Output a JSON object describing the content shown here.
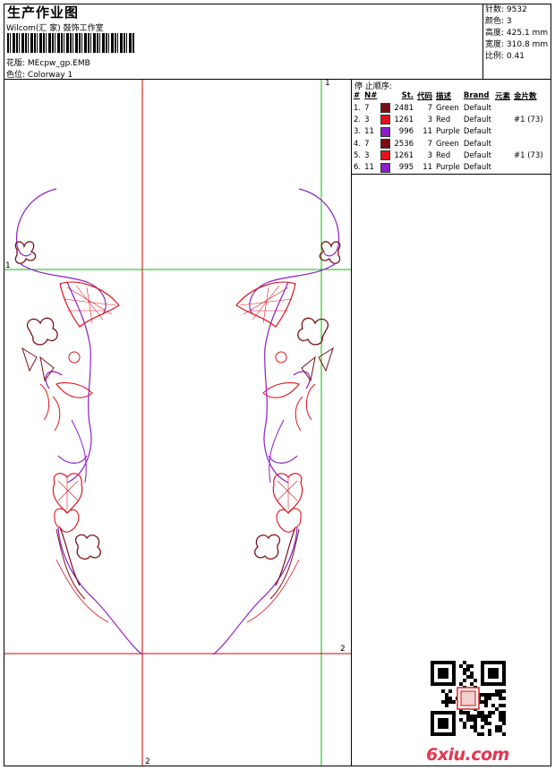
{
  "header": {
    "title": "生产作业图",
    "company": "Wilcom(汇 家) 鼓饰工作室",
    "design_label": "花版:",
    "design_value": "MEcpw_gp.EMB",
    "colorway_label": "色位:",
    "colorway_value": "Colorway 1"
  },
  "stats": {
    "stitches_label": "针数:",
    "stitches": "9532",
    "colors_label": "颜色:",
    "colors": "3",
    "height_label": "高度:",
    "height": "425.1 mm",
    "width_label": "宽度:",
    "width": "310.8 mm",
    "scale_label": "比例:",
    "scale": "0.41"
  },
  "sequence": {
    "title": "停 止顺序:",
    "headers": [
      "#",
      "N#",
      "St.",
      "代码",
      "描述",
      "Brand",
      "元素",
      "金片数"
    ],
    "rows": [
      {
        "idx": "1.",
        "n": "7",
        "color": "#7a0f14",
        "st": "2481",
        "code": "7",
        "desc": "Green",
        "brand": "Default",
        "elem": "",
        "seq": ""
      },
      {
        "idx": "2.",
        "n": "3",
        "color": "#e0141e",
        "st": "1261",
        "code": "3",
        "desc": "Red",
        "brand": "Default",
        "elem": "",
        "seq": "#1 (73)"
      },
      {
        "idx": "3.",
        "n": "11",
        "color": "#8a1ec8",
        "st": "996",
        "code": "11",
        "desc": "Purple",
        "brand": "Default",
        "elem": "",
        "seq": ""
      },
      {
        "idx": "4.",
        "n": "7",
        "color": "#7a0f14",
        "st": "2536",
        "code": "7",
        "desc": "Green",
        "brand": "Default",
        "elem": "",
        "seq": ""
      },
      {
        "idx": "5.",
        "n": "3",
        "color": "#e0141e",
        "st": "1261",
        "code": "3",
        "desc": "Red",
        "brand": "Default",
        "elem": "",
        "seq": "#1 (73)"
      },
      {
        "idx": "6.",
        "n": "11",
        "color": "#8a1ec8",
        "st": "995",
        "code": "11",
        "desc": "Purple",
        "brand": "Default",
        "elem": "",
        "seq": ""
      }
    ]
  },
  "guides": {
    "label_1_top": "1",
    "label_1_left": "1",
    "label_2_right": "2",
    "label_2_bottom": "2"
  },
  "watermark": {
    "brand": "6xiu.com"
  },
  "colors": {
    "guide_red": "#d40000",
    "guide_green": "#00c000",
    "dark_red": "#7a0f14",
    "red": "#e0141e",
    "purple": "#8a1ec8"
  }
}
